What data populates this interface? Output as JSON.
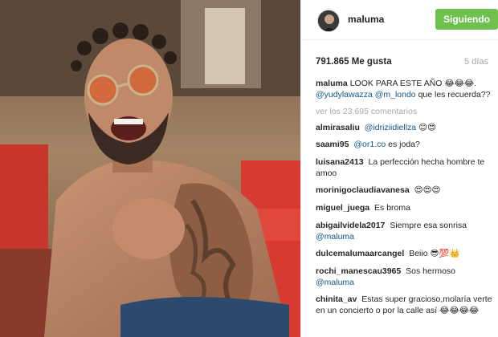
{
  "post": {
    "username": "maluma",
    "follow_label": "Siguiendo",
    "likes": "791.865 Me gusta",
    "time_ago": "5 días",
    "caption": {
      "user": "maluma",
      "text": "LOOK PARA ESTE AÑO 😂😂😂.",
      "mention1": "@yudylawazza",
      "mention2": "@m_londo",
      "text2": "que les recuerda??"
    },
    "view_more": "ver los 23.695 comentarios"
  },
  "comments": [
    {
      "user": "almirasaliu",
      "mention": "@idriziidiellza",
      "text": "😊😍"
    },
    {
      "user": "saami95",
      "mention": "@or1.co",
      "text": "es joda?"
    },
    {
      "user": "luisana2413",
      "mention": "",
      "text": "La perfección hecha hombre te amoo"
    },
    {
      "user": "morinigoclaudiavanesa",
      "mention": "",
      "text": "😍😍😍"
    },
    {
      "user": "miguel_juega",
      "mention": "",
      "text": "Es broma"
    },
    {
      "user": "abigailvidela2017",
      "mention": "",
      "text": "Siempre esa sonrisa",
      "mention_after": "@maluma"
    },
    {
      "user": "dulcemalumaarcangel",
      "mention": "",
      "text": "Beiio 😎💯👑"
    },
    {
      "user": "rochi_manescau3965",
      "mention": "",
      "text": "Sos hermoso",
      "mention_after": "@maluma"
    },
    {
      "user": "chinita_av",
      "mention": "",
      "text": "Estas super gracioso,molaría verte en un concierto o por la calle así 😂😂😂😂"
    }
  ],
  "colors": {
    "follow_button": "#70c050",
    "mention": "#125688",
    "muted": "#a5a7aa"
  }
}
